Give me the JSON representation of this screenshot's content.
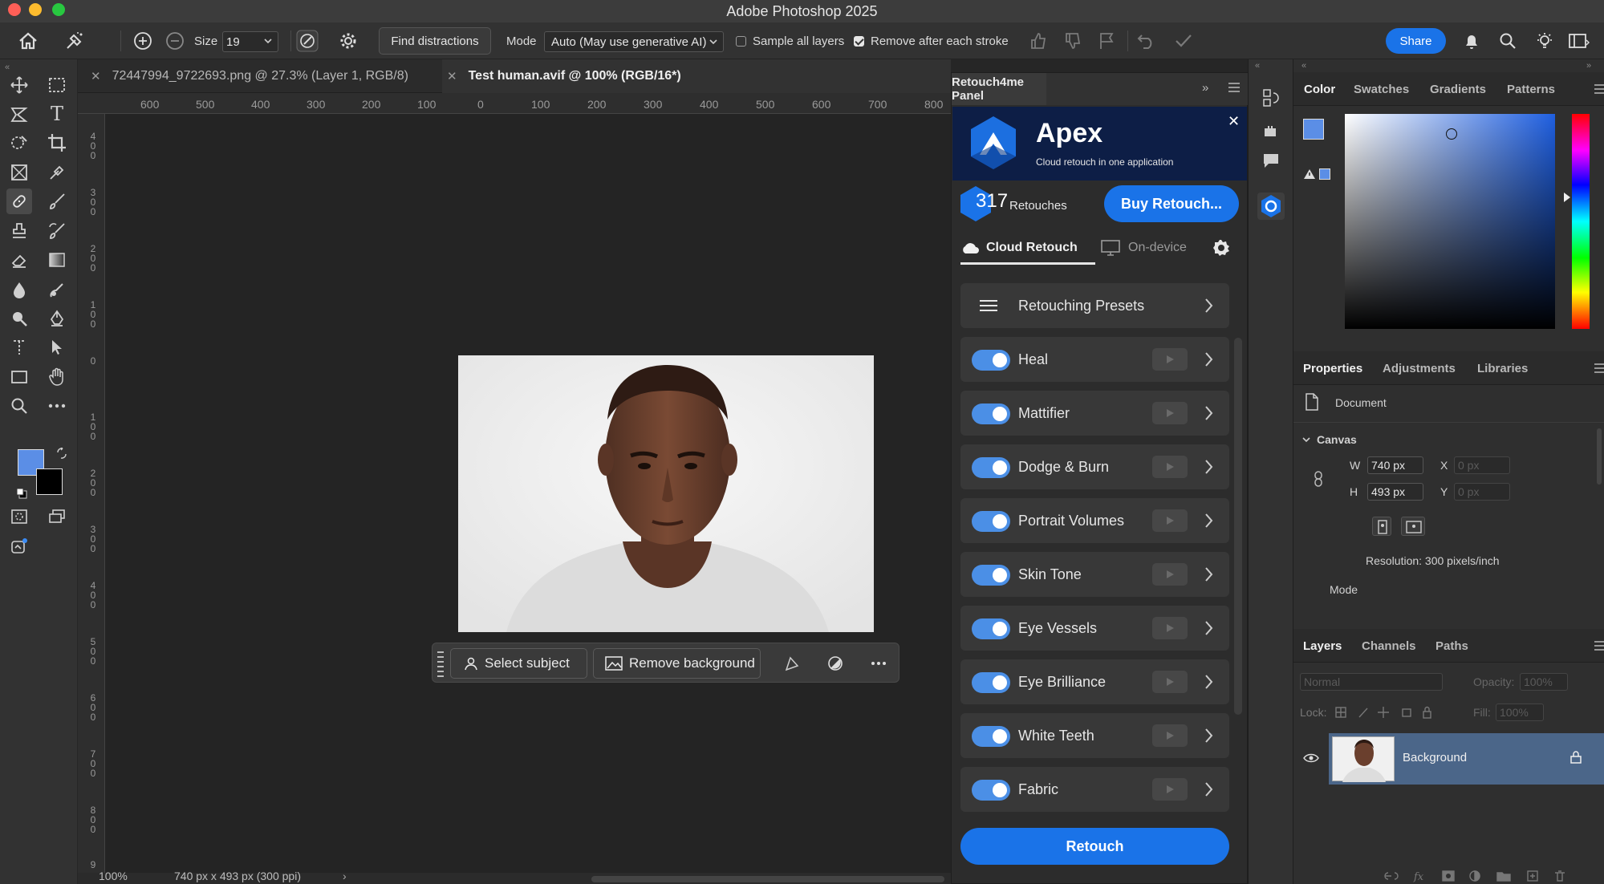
{
  "app": {
    "title": "Adobe Photoshop 2025"
  },
  "options_bar": {
    "size_label": "Size",
    "size_value": "19",
    "find_distractions": "Find distractions",
    "mode_label": "Mode",
    "mode_value": "Auto (May use generative AI)",
    "sample_all_layers": "Sample all layers",
    "sample_all_layers_checked": false,
    "remove_after_stroke": "Remove after each stroke",
    "remove_after_stroke_checked": true,
    "share": "Share"
  },
  "doc_tabs": [
    {
      "label": "72447994_9722693.png @ 27.3% (Layer 1, RGB/8)",
      "active": false
    },
    {
      "label": "Test human.avif @ 100% (RGB/16*)",
      "active": true
    }
  ],
  "ruler": {
    "h_ticks": [
      "600",
      "500",
      "400",
      "300",
      "200",
      "100",
      "0",
      "100",
      "200",
      "300",
      "400",
      "500",
      "600",
      "700",
      "800"
    ],
    "v_ticks": [
      "400",
      "300",
      "200",
      "100",
      "0",
      "100",
      "200",
      "300",
      "400",
      "500",
      "600",
      "700",
      "800",
      "9"
    ]
  },
  "status_bar": {
    "zoom": "100%",
    "doc_info": "740 px x 493 px (300 ppi)"
  },
  "task_bar": {
    "select_subject": "Select subject",
    "remove_background": "Remove background"
  },
  "retouch_panel": {
    "tab": "Retouch4me Panel",
    "banner_title": "Apex",
    "banner_subtitle": "Cloud retouch in one application",
    "retouches_count": "317",
    "retouches_label": "Retouches",
    "buy_button": "Buy Retouch...",
    "mode_tabs": [
      {
        "label": "Cloud Retouch",
        "active": true
      },
      {
        "label": "On-device",
        "active": false
      }
    ],
    "presets_label": "Retouching Presets",
    "features": [
      {
        "label": "Heal",
        "enabled": true
      },
      {
        "label": "Mattifier",
        "enabled": true
      },
      {
        "label": "Dodge & Burn",
        "enabled": true
      },
      {
        "label": "Portrait Volumes",
        "enabled": true
      },
      {
        "label": "Skin Tone",
        "enabled": true
      },
      {
        "label": "Eye Vessels",
        "enabled": true
      },
      {
        "label": "Eye Brilliance",
        "enabled": true
      },
      {
        "label": "White Teeth",
        "enabled": true
      },
      {
        "label": "Fabric",
        "enabled": true
      }
    ],
    "retouch_button": "Retouch"
  },
  "color_panel": {
    "tabs": [
      "Color",
      "Swatches",
      "Gradients",
      "Patterns"
    ],
    "foreground": "#5b8ee6",
    "background": "#000000"
  },
  "properties_panel": {
    "tabs": [
      "Properties",
      "Adjustments",
      "Libraries"
    ],
    "document_label": "Document",
    "canvas_label": "Canvas",
    "w_label": "W",
    "w_value": "740 px",
    "h_label": "H",
    "h_value": "493 px",
    "x_label": "X",
    "x_value": "0 px",
    "y_label": "Y",
    "y_value": "0 px",
    "resolution": "Resolution: 300 pixels/inch",
    "mode_label": "Mode"
  },
  "layers_panel": {
    "tabs": [
      "Layers",
      "Channels",
      "Paths"
    ],
    "blend_mode": "Normal",
    "opacity_label": "Opacity:",
    "opacity_value": "100%",
    "lock_label": "Lock:",
    "fill_label": "Fill:",
    "fill_value": "100%",
    "layers": [
      {
        "name": "Background",
        "visible": true,
        "locked": true
      }
    ]
  },
  "colors": {
    "accent": "#1a73e8",
    "toggle": "#4b8fe6",
    "banner": "#0d1e46",
    "selection": "#4b6689"
  }
}
